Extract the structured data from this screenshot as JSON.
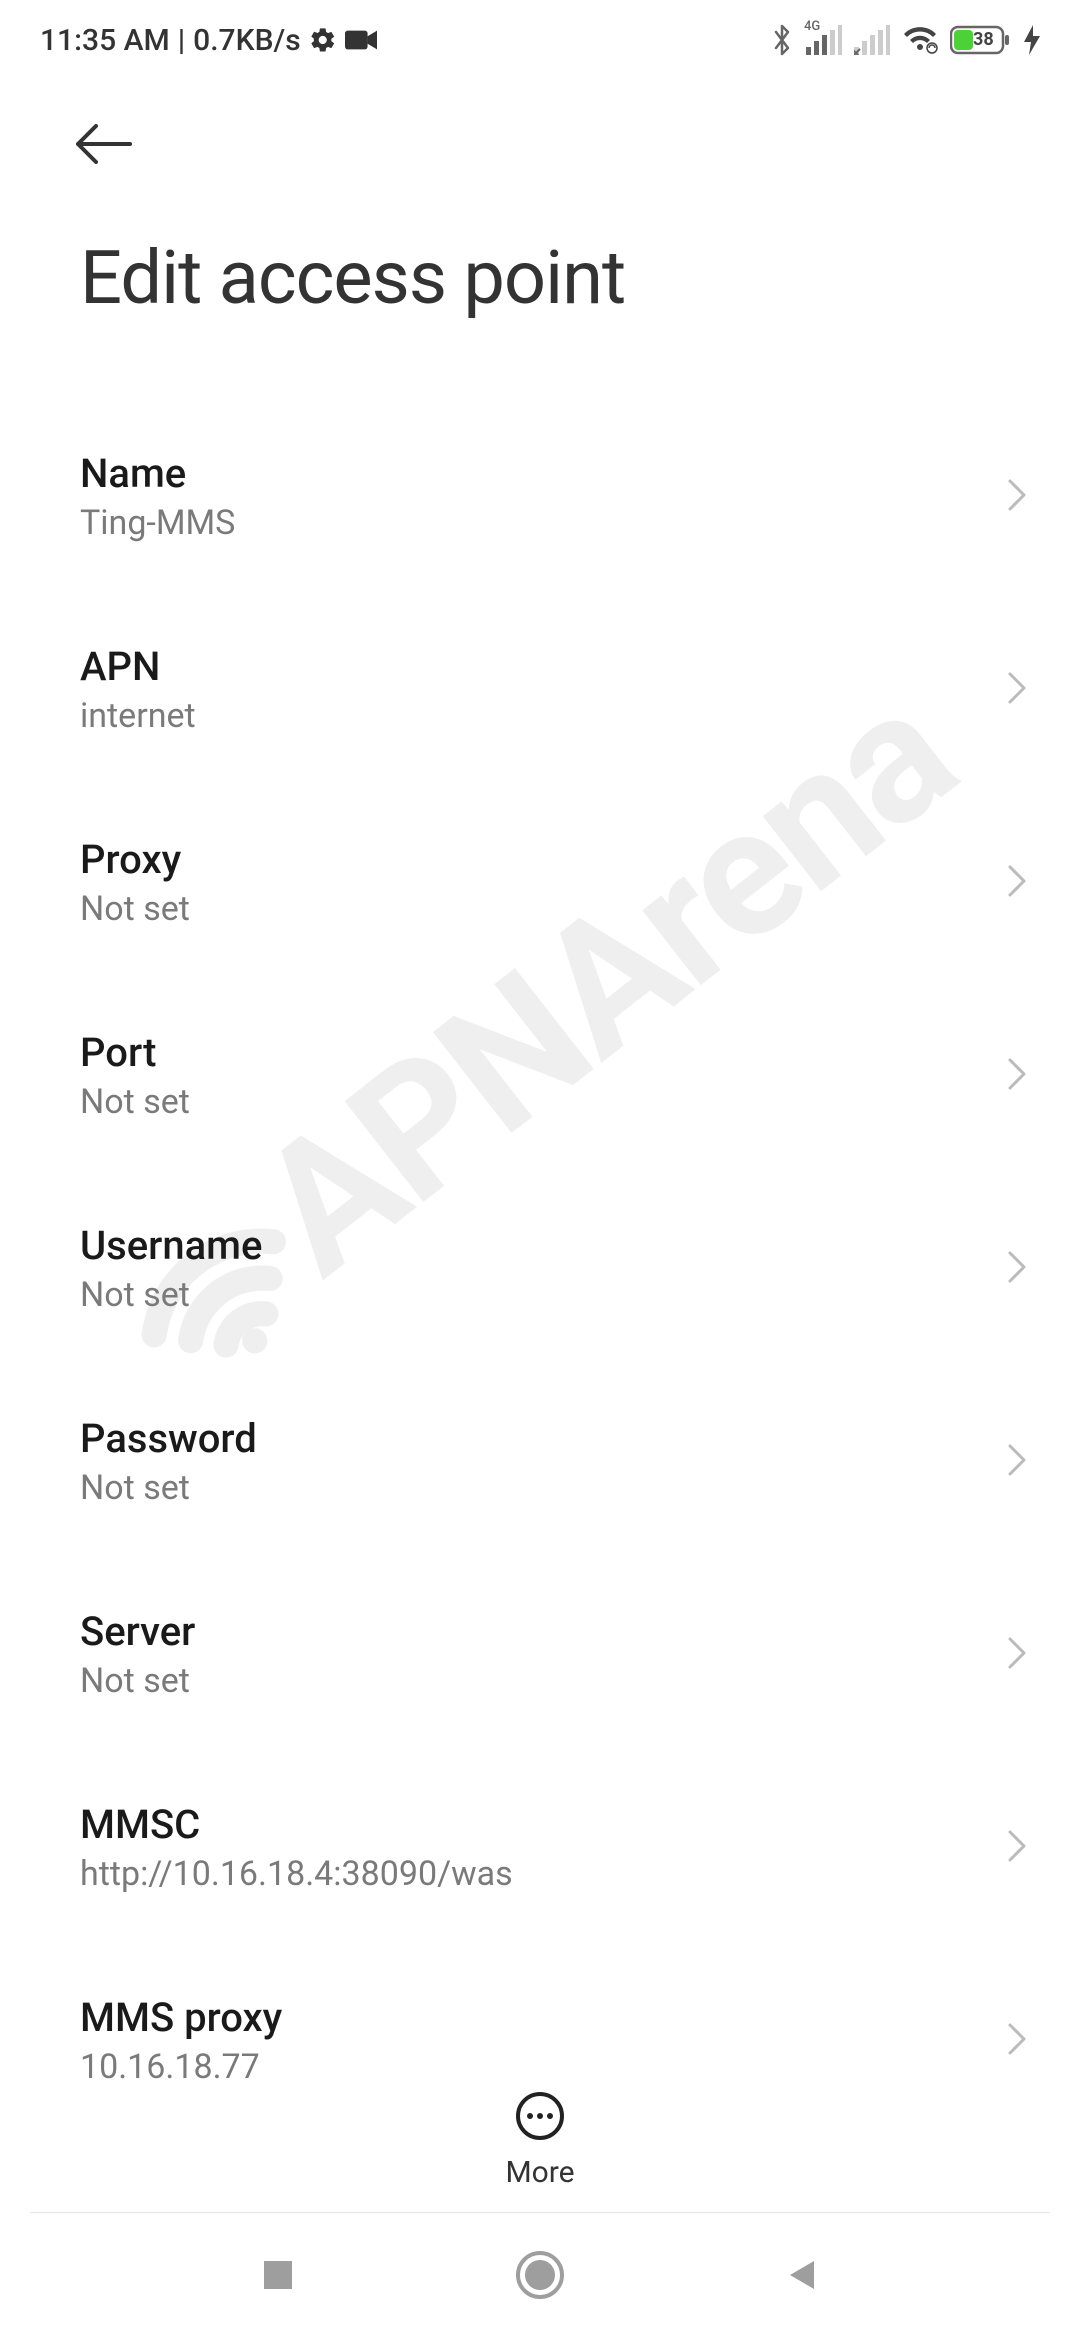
{
  "status": {
    "time": "11:35 AM",
    "sep": " | ",
    "speed": "0.7KB/s",
    "signal_label": "4G",
    "battery": "38"
  },
  "header": {
    "title": "Edit access point"
  },
  "rows": [
    {
      "label": "Name",
      "value": "Ting-MMS"
    },
    {
      "label": "APN",
      "value": "internet"
    },
    {
      "label": "Proxy",
      "value": "Not set"
    },
    {
      "label": "Port",
      "value": "Not set"
    },
    {
      "label": "Username",
      "value": "Not set"
    },
    {
      "label": "Password",
      "value": "Not set"
    },
    {
      "label": "Server",
      "value": "Not set"
    },
    {
      "label": "MMSC",
      "value": "http://10.16.18.4:38090/was"
    },
    {
      "label": "MMS proxy",
      "value": "10.16.18.77"
    }
  ],
  "more_label": "More",
  "watermark": "APNArena"
}
